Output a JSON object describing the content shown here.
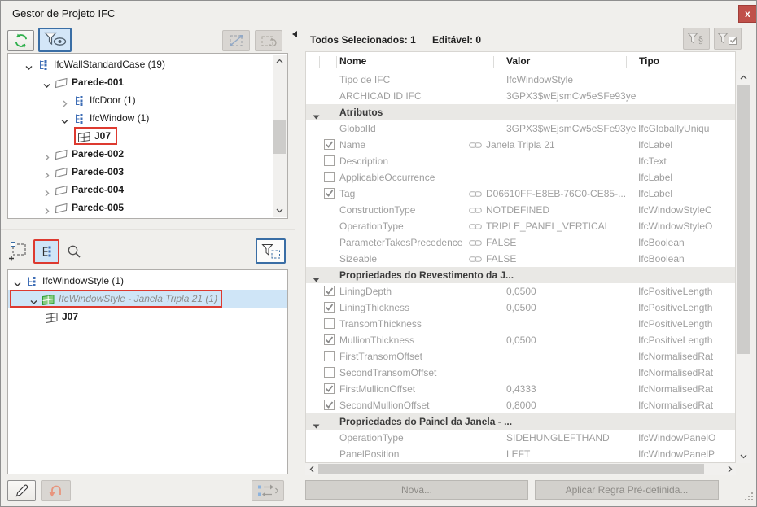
{
  "window": {
    "title": "Gestor de Projeto IFC",
    "close_glyph": "x"
  },
  "colors": {
    "highlight_red": "#dd3a30",
    "selection_blue": "#cfe5f7",
    "close_red": "#c0504a",
    "active_border_blue": "#3a6ea5",
    "sync_green": "#2eaf4b"
  },
  "left_panel": {
    "toolbar_top": [
      {
        "name": "sync-button",
        "icon": "sync-icon",
        "state": "enabled"
      },
      {
        "name": "filter-visibility-button",
        "icon": "filter-eye-icon",
        "state": "active"
      },
      {
        "name": "link-marquee-button",
        "icon": "marquee-link-icon",
        "state": "disabled"
      },
      {
        "name": "rotate-marquee-button",
        "icon": "marquee-rotate-icon",
        "state": "disabled"
      }
    ],
    "upper_tree": [
      {
        "label": "IfcWallStandardCase (19)",
        "level": 1,
        "expand": "open",
        "icon": "hierarchy-icon",
        "bold": false
      },
      {
        "label": "Parede-001",
        "level": 2,
        "expand": "open",
        "icon": "wall-icon",
        "bold": true
      },
      {
        "label": "IfcDoor (1)",
        "level": 3,
        "expand": "closed",
        "icon": "hierarchy-icon",
        "bold": false
      },
      {
        "label": "IfcWindow (1)",
        "level": 3,
        "expand": "open",
        "icon": "hierarchy-icon",
        "bold": false
      },
      {
        "label": "J07",
        "level": 4,
        "expand": "leaf",
        "icon": "window-icon",
        "bold": true,
        "red_box": true
      },
      {
        "label": "Parede-002",
        "level": 2,
        "expand": "closed",
        "icon": "wall-icon",
        "bold": true
      },
      {
        "label": "Parede-003",
        "level": 2,
        "expand": "closed",
        "icon": "wall-icon",
        "bold": true
      },
      {
        "label": "Parede-004",
        "level": 2,
        "expand": "closed",
        "icon": "wall-icon",
        "bold": true
      },
      {
        "label": "Parede-005",
        "level": 2,
        "expand": "closed",
        "icon": "wall-icon",
        "bold": true
      }
    ],
    "toolbar_middle": [
      {
        "name": "add-marquee-button",
        "icon": "marquee-plus-icon",
        "state": "flat"
      },
      {
        "name": "tree-view-button",
        "icon": "tree-view-icon",
        "state": "active-red"
      },
      {
        "name": "search-button",
        "icon": "magnifier-icon",
        "state": "flat"
      },
      {
        "name": "filter-marquee-button",
        "icon": "filter-marquee-icon",
        "state": "outlined"
      }
    ],
    "lower_tree": [
      {
        "label": "IfcWindowStyle (1)",
        "level": 1,
        "expand": "open",
        "icon": "hierarchy-icon",
        "bold": false
      },
      {
        "label": "IfcWindowStyle - Janela Tripla 21 (1)",
        "level": 2,
        "expand": "open",
        "icon": "window-green-icon",
        "italic": true,
        "selected": true,
        "red_box": true
      },
      {
        "label": "J07",
        "level": 3,
        "expand": "leaf",
        "icon": "window-icon",
        "bold": true
      }
    ],
    "toolbar_bottom": [
      {
        "name": "edit-button",
        "icon": "pencil-icon",
        "state": "enabled"
      },
      {
        "name": "undo-button",
        "icon": "undo-icon",
        "state": "disabled"
      },
      {
        "name": "sync-selection-button",
        "icon": "sync-tree-icon",
        "state": "disabled"
      }
    ]
  },
  "right_panel": {
    "summary": {
      "selected_label": "Todos Selecionados: 1",
      "editable_label": "Editável: 0"
    },
    "filter_buttons": [
      {
        "name": "filter-properties-button",
        "icon": "filter-paragraph-icon",
        "state": "disabled"
      },
      {
        "name": "filter-checked-button",
        "icon": "filter-check-icon",
        "state": "disabled"
      }
    ],
    "table": {
      "columns": [
        "Nome",
        "Valor",
        "Tipo"
      ],
      "rows": [
        {
          "kind": "prop",
          "check": null,
          "ref": false,
          "name": "Tipo de IFC",
          "value": "IfcWindowStyle",
          "type": ""
        },
        {
          "kind": "prop",
          "check": null,
          "ref": false,
          "name": "ARCHICAD ID IFC",
          "value": "3GPX3$wEjsmCw5eSFe93ye",
          "type": ""
        },
        {
          "kind": "section",
          "name": "Atributos"
        },
        {
          "kind": "prop",
          "check": null,
          "ref": false,
          "name": "GlobalId",
          "value": "3GPX3$wEjsmCw5eSFe93ye",
          "type": "IfcGloballyUniqu"
        },
        {
          "kind": "prop",
          "check": "checked",
          "ref": true,
          "name": "Name",
          "value": "Janela Tripla 21",
          "type": "IfcLabel"
        },
        {
          "kind": "prop",
          "check": "unchecked",
          "ref": false,
          "name": "Description",
          "value": "",
          "type": "IfcText"
        },
        {
          "kind": "prop",
          "check": "unchecked",
          "ref": false,
          "name": "ApplicableOccurrence",
          "value": "",
          "type": "IfcLabel"
        },
        {
          "kind": "prop",
          "check": "checked",
          "ref": true,
          "name": "Tag",
          "value": "D06610FF-E8EB-76C0-CE85-...",
          "type": "IfcLabel"
        },
        {
          "kind": "prop",
          "check": null,
          "ref": true,
          "name": "ConstructionType",
          "value": "NOTDEFINED",
          "type": "IfcWindowStyleC"
        },
        {
          "kind": "prop",
          "check": null,
          "ref": true,
          "name": "OperationType",
          "value": "TRIPLE_PANEL_VERTICAL",
          "type": "IfcWindowStyleO"
        },
        {
          "kind": "prop",
          "check": null,
          "ref": true,
          "name": "ParameterTakesPrecedence",
          "value": "FALSE",
          "type": "IfcBoolean"
        },
        {
          "kind": "prop",
          "check": null,
          "ref": true,
          "name": "Sizeable",
          "value": "FALSE",
          "type": "IfcBoolean"
        },
        {
          "kind": "section",
          "name": "Propriedades do Revestimento da J..."
        },
        {
          "kind": "prop",
          "check": "checked",
          "ref": false,
          "name": "LiningDepth",
          "value": "0,0500",
          "type": "IfcPositiveLength"
        },
        {
          "kind": "prop",
          "check": "checked",
          "ref": false,
          "name": "LiningThickness",
          "value": "0,0500",
          "type": "IfcPositiveLength"
        },
        {
          "kind": "prop",
          "check": "unchecked",
          "ref": false,
          "name": "TransomThickness",
          "value": "",
          "type": "IfcPositiveLength"
        },
        {
          "kind": "prop",
          "check": "checked",
          "ref": false,
          "name": "MullionThickness",
          "value": "0,0500",
          "type": "IfcPositiveLength"
        },
        {
          "kind": "prop",
          "check": "unchecked",
          "ref": false,
          "name": "FirstTransomOffset",
          "value": "",
          "type": "IfcNormalisedRat"
        },
        {
          "kind": "prop",
          "check": "unchecked",
          "ref": false,
          "name": "SecondTransomOffset",
          "value": "",
          "type": "IfcNormalisedRat"
        },
        {
          "kind": "prop",
          "check": "checked",
          "ref": false,
          "name": "FirstMullionOffset",
          "value": "0,4333",
          "type": "IfcNormalisedRat"
        },
        {
          "kind": "prop",
          "check": "checked",
          "ref": false,
          "name": "SecondMullionOffset",
          "value": "0,8000",
          "type": "IfcNormalisedRat"
        },
        {
          "kind": "section",
          "name": "Propriedades do Painel da Janela - ..."
        },
        {
          "kind": "prop",
          "check": null,
          "ref": false,
          "name": "OperationType",
          "value": "SIDEHUNGLEFTHAND",
          "type": "IfcWindowPanelO"
        },
        {
          "kind": "prop",
          "check": null,
          "ref": false,
          "name": "PanelPosition",
          "value": "LEFT",
          "type": "IfcWindowPanelP"
        }
      ]
    },
    "footer_buttons": [
      {
        "label": "Nova...",
        "state": "disabled"
      },
      {
        "label": "Aplicar Regra Pré-definida...",
        "state": "disabled"
      }
    ]
  }
}
